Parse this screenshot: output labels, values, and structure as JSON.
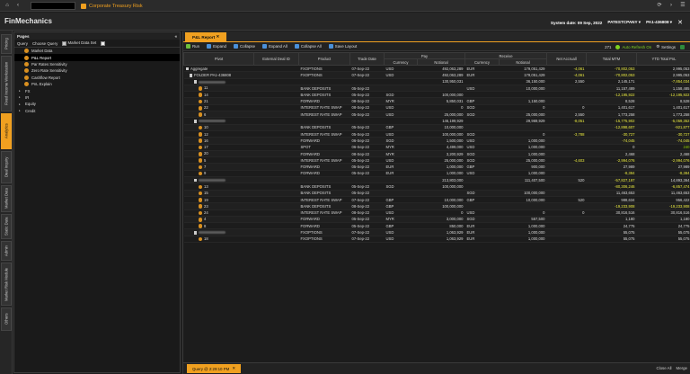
{
  "browser": {
    "tab_title": "Corporate Treasury Risk"
  },
  "app": {
    "title": "FinMechanics",
    "system_date_label": "System date: 09 Sep, 2022",
    "user": "PATESTCPANY",
    "entity": "PA1-436808"
  },
  "vnav": [
    {
      "label": "Pricing",
      "active": false
    },
    {
      "label": "Fixed Income Workstation",
      "active": false
    },
    {
      "label": "Analytics",
      "active": true
    },
    {
      "label": "Deal Inquiry",
      "active": false
    },
    {
      "label": "Market Data",
      "active": false
    },
    {
      "label": "Static Data",
      "active": false
    },
    {
      "label": "Admin",
      "active": false
    },
    {
      "label": "Market Risk Module",
      "active": false
    },
    {
      "label": "Others",
      "active": false
    }
  ],
  "pages": {
    "title": "Pages",
    "query_label": "Query",
    "choose_query": "Choose Query",
    "market_data_set": "Market Data Set",
    "items": [
      {
        "label": "Market Data",
        "type": "page",
        "selected": false
      },
      {
        "label": "P&L Report",
        "type": "page",
        "selected": true
      },
      {
        "label": "Par Rates Sensitivity",
        "type": "page",
        "selected": false
      },
      {
        "label": "Zero Rate Sensitivity",
        "type": "page",
        "selected": false
      },
      {
        "label": "Cashflow Report",
        "type": "page",
        "selected": false
      },
      {
        "label": "PnL Explain",
        "type": "page",
        "selected": false
      },
      {
        "label": "FX",
        "type": "group",
        "selected": false
      },
      {
        "label": "IR",
        "type": "group",
        "selected": false
      },
      {
        "label": "Equity",
        "type": "group",
        "selected": false
      },
      {
        "label": "Credit",
        "type": "group",
        "selected": false
      }
    ]
  },
  "report": {
    "tab": "P&L Report",
    "toolbar": {
      "run": "Run",
      "expand": "Expand",
      "collapse": "Collapse",
      "expand_all": "Expand All",
      "collapse_all": "Collapse All",
      "save_layout": "Save Layout",
      "count": "271",
      "auto_refresh": "Auto Refresh On",
      "settings": "Settings"
    },
    "headers": {
      "pivot": "Pivot",
      "external_deal_id": "External Deal ID",
      "product": "Product",
      "trade_date": "Trade Date",
      "pay": "Pay",
      "receive": "Receive",
      "currency": "Currency",
      "notional": "Notional",
      "net_accrual": "Net Accruall",
      "total_mtm": "Total MTM",
      "ytd_total_pnl": "YTD Total PnL"
    },
    "rows": [
      {
        "level": 0,
        "icon": "box",
        "pivot": "Aggregate",
        "product": "FXOPTIONS",
        "date": "07-Sep-22",
        "pccy": "USD",
        "pnot": "492,063,289",
        "rccy": "EUR",
        "rnot": "179,051,429",
        "acc": "-4,061",
        "mtm": "-70,802,053",
        "ytd": "2,995,053",
        "mtmc": "neg",
        "ytdc": "num",
        "accc": "neg"
      },
      {
        "level": 1,
        "icon": "box",
        "pivot": "FOLDER PA1-436808",
        "product": "FXOPTIONS",
        "date": "07-Sep-22",
        "pccy": "USD",
        "pnot": "492,063,289",
        "rccy": "EUR",
        "rnot": "179,051,429",
        "acc": "-4,061",
        "mtm": "-70,802,053",
        "ytd": "2,995,053",
        "mtmc": "neg",
        "ytdc": "num",
        "accc": "neg"
      },
      {
        "level": 2,
        "icon": "box",
        "pivot": "",
        "blur": true,
        "product": "",
        "date": "",
        "pccy": "",
        "pnot": "130,950,031",
        "rccy": "",
        "rnot": "36,150,000",
        "acc": "2,550",
        "mtm": "2,145,171",
        "ytd": "-7,854,034",
        "mtmc": "num",
        "ytdc": "neg",
        "accc": "num"
      },
      {
        "level": 3,
        "icon": "ico",
        "pivot": "11",
        "product": "BANK DEPOSITS",
        "date": "05-Sep-22",
        "pccy": "",
        "pnot": "",
        "rccy": "USD",
        "rnot": "10,000,000",
        "acc": "",
        "mtm": "11,157,489",
        "ytd": "1,158,485",
        "mtmc": "num",
        "ytdc": "num",
        "accc": "num"
      },
      {
        "level": 3,
        "icon": "ico",
        "pivot": "14",
        "product": "BANK DEPOSITS",
        "date": "05-Sep-22",
        "pccy": "SGD",
        "pnot": "100,000,000",
        "rccy": "",
        "rnot": "",
        "acc": "",
        "mtm": "-12,195,922",
        "ytd": "-12,195,922",
        "mtmc": "neg",
        "ytdc": "neg",
        "accc": "num"
      },
      {
        "level": 3,
        "icon": "ico",
        "pivot": "21",
        "product": "FORWARD",
        "date": "08-Sep-22",
        "pccy": "MYR",
        "pnot": "5,850,031",
        "rccy": "GBP",
        "rnot": "1,150,000",
        "acc": "",
        "mtm": "8,528",
        "ytd": "8,528",
        "mtmc": "num",
        "ytdc": "num",
        "accc": "num"
      },
      {
        "level": 3,
        "icon": "ico",
        "pivot": "22",
        "product": "INTEREST RATE SWAP",
        "date": "08-Sep-22",
        "pccy": "USD",
        "pnot": "0",
        "rccy": "SGD",
        "rnot": "0",
        "acc": "0",
        "mtm": "1,401,617",
        "ytd": "1,401,617",
        "mtmc": "num",
        "ytdc": "num",
        "accc": "num"
      },
      {
        "level": 3,
        "icon": "ico",
        "pivot": "6",
        "product": "INTEREST RATE SWAP",
        "date": "05-Sep-22",
        "pccy": "USD",
        "pnot": "25,000,000",
        "rccy": "SGD",
        "rnot": "25,000,000",
        "acc": "2,550",
        "mtm": "1,773,258",
        "ytd": "1,773,258",
        "mtmc": "num",
        "ytdc": "num",
        "accc": "num"
      },
      {
        "level": 2,
        "icon": "box",
        "pivot": "",
        "blur": true,
        "product": "",
        "date": "",
        "pccy": "",
        "pnot": "146,199,929",
        "rccy": "",
        "rnot": "29,969,929",
        "acc": "-8,051",
        "mtm": "-15,775,902",
        "ytd": "-5,059,352",
        "mtmc": "neg",
        "ytdc": "neg",
        "accc": "neg"
      },
      {
        "level": 3,
        "icon": "ico",
        "pivot": "10",
        "product": "BANK DEPOSITS",
        "date": "05-Sep-22",
        "pccy": "GBP",
        "pnot": "10,000,000",
        "rccy": "",
        "rnot": "",
        "acc": "",
        "mtm": "-12,898,607",
        "ytd": "-921,877",
        "mtmc": "neg",
        "ytdc": "neg",
        "accc": "num"
      },
      {
        "level": 3,
        "icon": "ico",
        "pivot": "12",
        "product": "INTEREST RATE SWAP",
        "date": "05-Sep-22",
        "pccy": "USD",
        "pnot": "100,000,000",
        "rccy": "SGD",
        "rnot": "0",
        "acc": "-3,788",
        "mtm": "-30,727",
        "ytd": "-30,727",
        "mtmc": "neg",
        "ytdc": "neg",
        "accc": "neg"
      },
      {
        "level": 3,
        "icon": "ico",
        "pivot": "16",
        "product": "FORWARD",
        "date": "06-Sep-22",
        "pccy": "SGD",
        "pnot": "1,500,000",
        "rccy": "USD",
        "rnot": "1,000,000",
        "acc": "",
        "mtm": "-74,045",
        "ytd": "-74,045",
        "mtmc": "neg",
        "ytdc": "neg",
        "accc": "num"
      },
      {
        "level": 3,
        "icon": "ico",
        "pivot": "17",
        "product": "SPOT",
        "date": "06-Sep-22",
        "pccy": "MYR",
        "pnot": "4,499,000",
        "rccy": "USD",
        "rnot": "1,000,000",
        "acc": "",
        "mtm": "0",
        "ytd": "240",
        "mtmc": "num",
        "ytdc": "pos",
        "accc": "num"
      },
      {
        "level": 3,
        "icon": "ico",
        "pivot": "20",
        "product": "FORWARD",
        "date": "08-Sep-22",
        "pccy": "MYR",
        "pnot": "3,200,929",
        "rccy": "SGD",
        "rnot": "1,000,000",
        "acc": "",
        "mtm": "2,468",
        "ytd": "2,468",
        "mtmc": "num",
        "ytdc": "num",
        "accc": "num"
      },
      {
        "level": 3,
        "icon": "ico",
        "pivot": "5",
        "product": "INTEREST RATE SWAP",
        "date": "05-Sep-22",
        "pccy": "USD",
        "pnot": "25,000,000",
        "rccy": "SGD",
        "rnot": "25,000,000",
        "acc": "-4,603",
        "mtm": "-2,994,076",
        "ytd": "-2,994,076",
        "mtmc": "neg",
        "ytdc": "neg",
        "accc": "neg"
      },
      {
        "level": 3,
        "icon": "ico",
        "pivot": "7",
        "product": "FORWARD",
        "date": "05-Sep-22",
        "pccy": "EUR",
        "pnot": "1,000,000",
        "rccy": "GBP",
        "rnot": "900,000",
        "acc": "",
        "mtm": "27,989",
        "ytd": "27,989",
        "mtmc": "num",
        "ytdc": "num",
        "accc": "num"
      },
      {
        "level": 3,
        "icon": "ico",
        "pivot": "9",
        "product": "FORWARD",
        "date": "05-Sep-22",
        "pccy": "EUR",
        "pnot": "1,000,000",
        "rccy": "USD",
        "rnot": "1,000,000",
        "acc": "",
        "mtm": "-8,384",
        "ytd": "-8,384",
        "mtmc": "neg",
        "ytdc": "neg",
        "accc": "num"
      },
      {
        "level": 2,
        "icon": "box",
        "pivot": "",
        "blur": true,
        "product": "",
        "date": "",
        "pccy": "",
        "pnot": "213,803,000",
        "rccy": "",
        "rnot": "111,407,500",
        "acc": "520",
        "mtm": "-57,827,197",
        "ytd": "14,893,364",
        "mtmc": "neg",
        "ytdc": "num",
        "accc": "num"
      },
      {
        "level": 3,
        "icon": "ico",
        "pivot": "13",
        "product": "BANK DEPOSITS",
        "date": "05-Sep-22",
        "pccy": "SGD",
        "pnot": "100,000,000",
        "rccy": "",
        "rnot": "",
        "acc": "",
        "mtm": "-80,306,246",
        "ytd": "-6,857,474",
        "mtmc": "neg",
        "ytdc": "neg",
        "accc": "num"
      },
      {
        "level": 3,
        "icon": "ico",
        "pivot": "15",
        "product": "BANK DEPOSITS",
        "date": "05-Sep-22",
        "pccy": "",
        "pnot": "",
        "rccy": "SGD",
        "rnot": "100,000,000",
        "acc": "",
        "mtm": "11,463,653",
        "ytd": "11,463,653",
        "mtmc": "num",
        "ytdc": "num",
        "accc": "num"
      },
      {
        "level": 3,
        "icon": "ico",
        "pivot": "19",
        "product": "INTEREST RATE SWAP",
        "date": "07-Sep-22",
        "pccy": "GBP",
        "pnot": "10,000,000",
        "rccy": "GBP",
        "rnot": "10,000,000",
        "acc": "520",
        "mtm": "988,634",
        "ytd": "956,422",
        "mtmc": "num",
        "ytdc": "num",
        "accc": "num"
      },
      {
        "level": 3,
        "icon": "ico",
        "pivot": "23",
        "product": "BANK DEPOSITS",
        "date": "08-Sep-22",
        "pccy": "GBP",
        "pnot": "100,000,000",
        "rccy": "",
        "rnot": "",
        "acc": "",
        "mtm": "-19,233,908",
        "ytd": "-19,233,908",
        "mtmc": "neg",
        "ytdc": "neg",
        "accc": "num"
      },
      {
        "level": 3,
        "icon": "ico",
        "pivot": "24",
        "product": "INTEREST RATE SWAP",
        "date": "08-Sep-22",
        "pccy": "USD",
        "pnot": "0",
        "rccy": "USD",
        "rnot": "0",
        "acc": "0",
        "mtm": "30,816,516",
        "ytd": "30,816,516",
        "mtmc": "num",
        "ytdc": "num",
        "accc": "num"
      },
      {
        "level": 3,
        "icon": "ico",
        "pivot": "4",
        "product": "FORWARD",
        "date": "05-Sep-22",
        "pccy": "MYR",
        "pnot": "3,000,000",
        "rccy": "SGD",
        "rnot": "557,500",
        "acc": "",
        "mtm": "1,180",
        "ytd": "1,180",
        "mtmc": "num",
        "ytdc": "num",
        "accc": "num"
      },
      {
        "level": 3,
        "icon": "ico",
        "pivot": "8",
        "product": "FORWARD",
        "date": "05-Sep-22",
        "pccy": "GBP",
        "pnot": "850,000",
        "rccy": "EUR",
        "rnot": "1,000,000",
        "acc": "",
        "mtm": "24,775",
        "ytd": "24,775",
        "mtmc": "num",
        "ytdc": "num",
        "accc": "num"
      },
      {
        "level": 2,
        "icon": "box",
        "pivot": "",
        "blur": true,
        "product": "FXOPTIONS",
        "date": "07-Sep-22",
        "pccy": "USD",
        "pnot": "1,063,929",
        "rccy": "EUR",
        "rnot": "1,000,000",
        "acc": "",
        "mtm": "55,075",
        "ytd": "55,075",
        "mtmc": "num",
        "ytdc": "num",
        "accc": "num"
      },
      {
        "level": 3,
        "icon": "ico",
        "pivot": "18",
        "product": "FXOPTIONS",
        "date": "07-Sep-22",
        "pccy": "USD",
        "pnot": "1,063,929",
        "rccy": "EUR",
        "rnot": "1,000,000",
        "acc": "",
        "mtm": "55,075",
        "ytd": "55,075",
        "mtmc": "num",
        "ytdc": "num",
        "accc": "num"
      }
    ],
    "footer": {
      "query_tab": "Query @ 2:29:10 PM",
      "close_all": "Close All",
      "merge": "Merge"
    }
  },
  "colors": {
    "accent": "#f0a020",
    "negative": "#e8e840",
    "positive": "#8fd000"
  }
}
